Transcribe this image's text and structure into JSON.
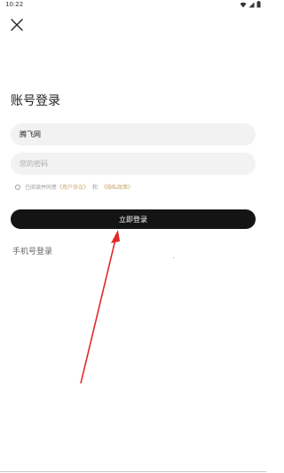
{
  "status_bar": {
    "time": "10:22"
  },
  "header": {
    "close_icon": "close-icon"
  },
  "page": {
    "title": "账号登录"
  },
  "form": {
    "username_value": "腾飞网",
    "password_placeholder": "您的密码"
  },
  "agreement": {
    "prefix": "已阅读并同意",
    "user_agreement": "《用户协议》",
    "conjunction": "和",
    "privacy_policy": "《隐私政策》"
  },
  "actions": {
    "login_label": "立即登录",
    "phone_login_label": "手机号登录"
  },
  "colors": {
    "button_bg": "#141414",
    "link": "#c9a66b",
    "field_bg": "#f2f2f2",
    "annotation_arrow": "#e02a2a"
  }
}
